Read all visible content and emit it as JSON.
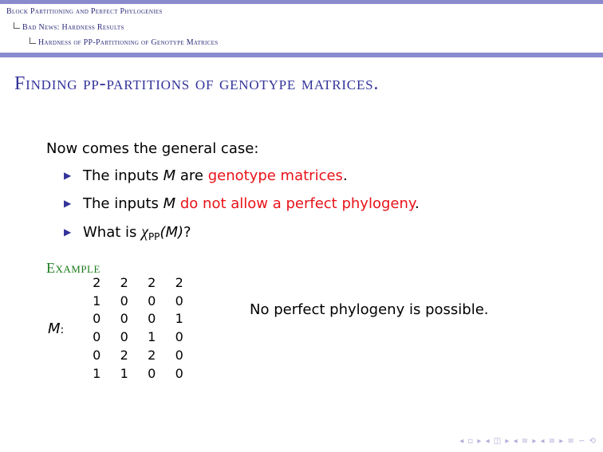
{
  "breadcrumb": {
    "level1": "Block Partitioning and Perfect Phylogenies",
    "level2": "Bad News: Hardness Results",
    "level3": "Hardness of PP-Partitioning of Genotype Matrices"
  },
  "slide": {
    "title": "Finding pp-partitions of genotype matrices.",
    "intro": "Now comes the general case:",
    "bullets": [
      {
        "pre": "The inputs ",
        "var": "M",
        "mid": " are ",
        "highlight": "genotype matrices",
        "post": "."
      },
      {
        "pre": "The inputs ",
        "var": "M",
        "mid": " ",
        "highlight": "do not allow a perfect phylogeny",
        "post": "."
      },
      {
        "pre": "What is ",
        "chi": "χ",
        "sub": "PP",
        "arg": "(M)",
        "post": "?"
      }
    ]
  },
  "example": {
    "title": "Example",
    "matrix_label": "M",
    "matrix_colon": ":",
    "matrix": [
      [
        "2",
        "2",
        "2",
        "2"
      ],
      [
        "1",
        "0",
        "0",
        "0"
      ],
      [
        "0",
        "0",
        "0",
        "1"
      ],
      [
        "0",
        "0",
        "1",
        "0"
      ],
      [
        "0",
        "2",
        "2",
        "0"
      ],
      [
        "1",
        "1",
        "0",
        "0"
      ]
    ],
    "note": "No perfect phylogeny is possible."
  },
  "colors": {
    "bar": "#8a8ace",
    "title": "#33339a",
    "highlight": "#e8121a",
    "example_title": "#1a7a1a"
  },
  "nav": {
    "symbols": "◂ ▫ ▸ ◂ ◫ ▸ ◂ ≡ ▸ ◂ ≡ ▸ ≡ ∽ ⟲"
  }
}
